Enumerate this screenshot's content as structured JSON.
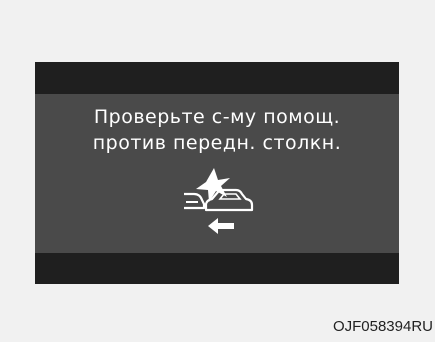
{
  "display": {
    "line1": "Проверьте с-му помощ.",
    "line2": "против передн. столкн.",
    "icon_name": "forward-collision-assist-warning-icon",
    "text_color": "#ffffff",
    "panel_color": "#4a4a4a",
    "bar_color": "#1f1f1f"
  },
  "caption": {
    "code": "OJF058394RU"
  }
}
